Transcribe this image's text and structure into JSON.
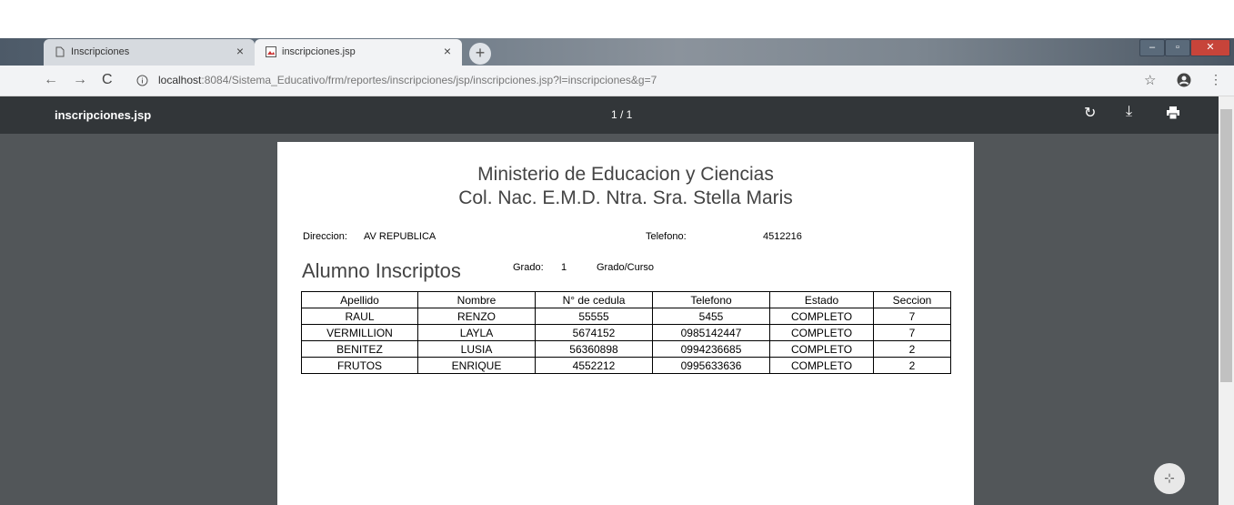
{
  "browser": {
    "tabs": [
      {
        "label": "Inscripciones",
        "close": "×"
      },
      {
        "label": "inscripciones.jsp",
        "close": "×"
      }
    ],
    "new_tab": "+",
    "url_host": "localhost",
    "url_rest": ":8084/Sistema_Educativo/frm/reportes/inscripciones/jsp/inscripciones.jsp?l=inscripciones&g=7"
  },
  "pdf": {
    "title": "inscripciones.jsp",
    "page_indicator": "1 / 1"
  },
  "report": {
    "title1": "Ministerio de Educacion y Ciencias",
    "title2": "Col. Nac. E.M.D. Ntra. Sra. Stella Maris",
    "direccion_label": "Direccion:",
    "direccion_value": "AV REPUBLICA",
    "telefono_label": "Telefono:",
    "telefono_value": "4512216",
    "section_title": "Alumno Inscriptos",
    "grado_label": "Grado:",
    "grado_value": "1",
    "grado_curso_label": "Grado/Curso",
    "table": {
      "headers": [
        "Apellido",
        "Nombre",
        "N° de cedula",
        "Telefono",
        "Estado",
        "Seccion"
      ],
      "rows": [
        [
          "RAUL",
          "RENZO",
          "55555",
          "5455",
          "COMPLETO",
          "7"
        ],
        [
          "VERMILLION",
          "LAYLA",
          "5674152",
          "0985142447",
          "COMPLETO",
          "7"
        ],
        [
          "BENITEZ",
          "LUSIA",
          "56360898",
          "0994236685",
          "COMPLETO",
          "2"
        ],
        [
          "FRUTOS",
          "ENRIQUE",
          "4552212",
          "0995633636",
          "COMPLETO",
          "2"
        ]
      ]
    }
  }
}
